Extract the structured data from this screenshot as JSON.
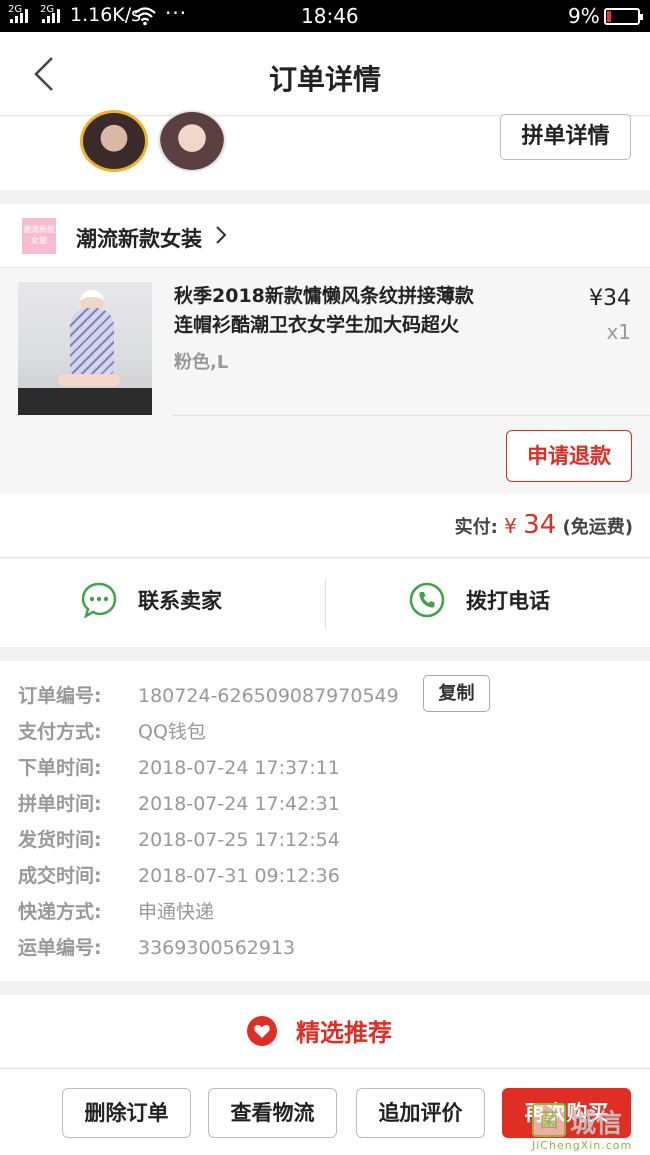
{
  "status_bar": {
    "net_left": "2G",
    "net_right": "2G",
    "speed": "1.16K/s",
    "dots": "···",
    "time": "18:46",
    "battery": "9%"
  },
  "nav": {
    "title": "订单详情"
  },
  "group": {
    "detail_button": "拼单详情"
  },
  "store": {
    "logo_text": "潮流新款女装",
    "name": "潮流新款女装"
  },
  "product": {
    "title_line1": "秋季2018新款慵懒风条纹拼接薄款",
    "title_line2": "连帽衫酷潮卫衣女学生加大码超火",
    "spec": "粉色,L",
    "price": "¥34",
    "qty": "x1",
    "refund_button": "申请退款"
  },
  "payment": {
    "label": "实付:",
    "currency": "¥",
    "amount": "34",
    "note": "(免运费)"
  },
  "contact": {
    "seller": "联系卖家",
    "call": "拨打电话"
  },
  "order_info": {
    "copy_button": "复制",
    "rows": [
      {
        "label": "订单编号:",
        "value": "180724-626509087970549"
      },
      {
        "label": "支付方式:",
        "value": "QQ钱包"
      },
      {
        "label": "下单时间:",
        "value": "2018-07-24 17:37:11"
      },
      {
        "label": "拼单时间:",
        "value": "2018-07-24 17:42:31"
      },
      {
        "label": "发货时间:",
        "value": "2018-07-25 17:12:54"
      },
      {
        "label": "成交时间:",
        "value": "2018-07-31 09:12:36"
      },
      {
        "label": "快递方式:",
        "value": "申通快递"
      },
      {
        "label": "运单编号:",
        "value": "3369300562913"
      }
    ]
  },
  "recommend": {
    "label": "精选推荐"
  },
  "bottom_bar": {
    "delete": "删除订单",
    "logistics": "查看物流",
    "review": "追加评价",
    "rebuy": "再次购买"
  },
  "watermark": {
    "logo": "菌",
    "text": "城信",
    "url": "JiChengXin.com"
  },
  "colors": {
    "accent": "#e02e24",
    "contact_green": "#3ea44a",
    "background": "#f2f2f2"
  }
}
